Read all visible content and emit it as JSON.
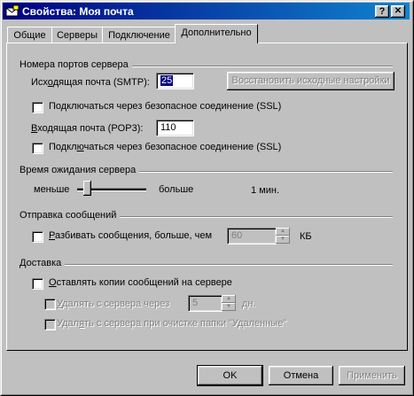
{
  "window": {
    "title": "Свойства: Моя почта",
    "help_btn": "?",
    "close_btn": "✕"
  },
  "tabs": [
    {
      "label": "Общие"
    },
    {
      "label": "Серверы"
    },
    {
      "label": "Подключение"
    },
    {
      "label": "Дополнительно"
    }
  ],
  "ports": {
    "group_title": "Номера портов сервера",
    "smtp_label_pre": "Исх",
    "smtp_label_u": "о",
    "smtp_label_post": "дящая почта (SMTP):",
    "smtp_value": "25",
    "restore_button": "Восстановить исходные настройки",
    "smtp_ssl_pre": "По",
    "smtp_ssl_u": "д",
    "smtp_ssl_post": "ключаться через безопасное соединение (SSL)",
    "pop3_label_pre": "",
    "pop3_label_u": "В",
    "pop3_label_post": "ходящая почта (POP3):",
    "pop3_value": "110",
    "pop3_ssl_pre": "Подкл",
    "pop3_ssl_u": "ю",
    "pop3_ssl_post": "чаться через безопасное соединение (SSL)"
  },
  "timeout": {
    "group_title": "Время ожидания сервера",
    "less": "меньше",
    "more": "больше",
    "value_text": "1 мин.",
    "level": 0.1
  },
  "sending": {
    "group_title": "Отправка сообщений",
    "split_pre": "",
    "split_u": "Р",
    "split_post": "азбивать сообщения, больше, чем",
    "split_value": "60",
    "unit": "КБ"
  },
  "delivery": {
    "group_title": "Доставка",
    "keep_pre": "",
    "keep_u": "О",
    "keep_post": "ставлять копии сообщений на сервере",
    "delete_after_pre": "",
    "delete_after_u": "У",
    "delete_after_post": "далять с сервера через",
    "delete_after_value": "5",
    "days": "дн.",
    "delete_on_empty_pre": "Удал",
    "delete_on_empty_u": "я",
    "delete_on_empty_post": "ть с сервера при очистке папки \"Удаленные\""
  },
  "footer": {
    "ok": "OK",
    "cancel": "Отмена",
    "apply": "Применить"
  },
  "colors": {
    "titlebar_start": "#000080",
    "titlebar_end": "#1084d0",
    "face": "#c0c0c0"
  }
}
